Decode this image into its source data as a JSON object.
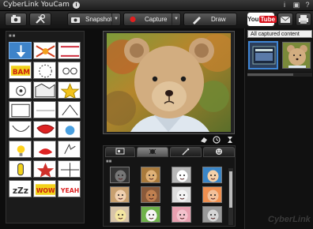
{
  "window": {
    "title": "CyberLink YouCam",
    "info_glyph": "i",
    "info_icon": "i",
    "settings_icon": "▣",
    "help_icon": "?"
  },
  "toolbar": {
    "snapshot_label": "Snapshot",
    "capture_label": "Capture",
    "draw_label": "Draw",
    "youtube_label": "You",
    "youtube_badge": "Tube",
    "capture_dot_color": "#e02020"
  },
  "right_panel": {
    "filter_select_value": "All captured content"
  },
  "effects": {
    "tabs": [
      "scene-tab",
      "avatar-tab",
      "magic-tab",
      "emotion-tab"
    ]
  },
  "logo": {
    "text": "CyberLink"
  }
}
